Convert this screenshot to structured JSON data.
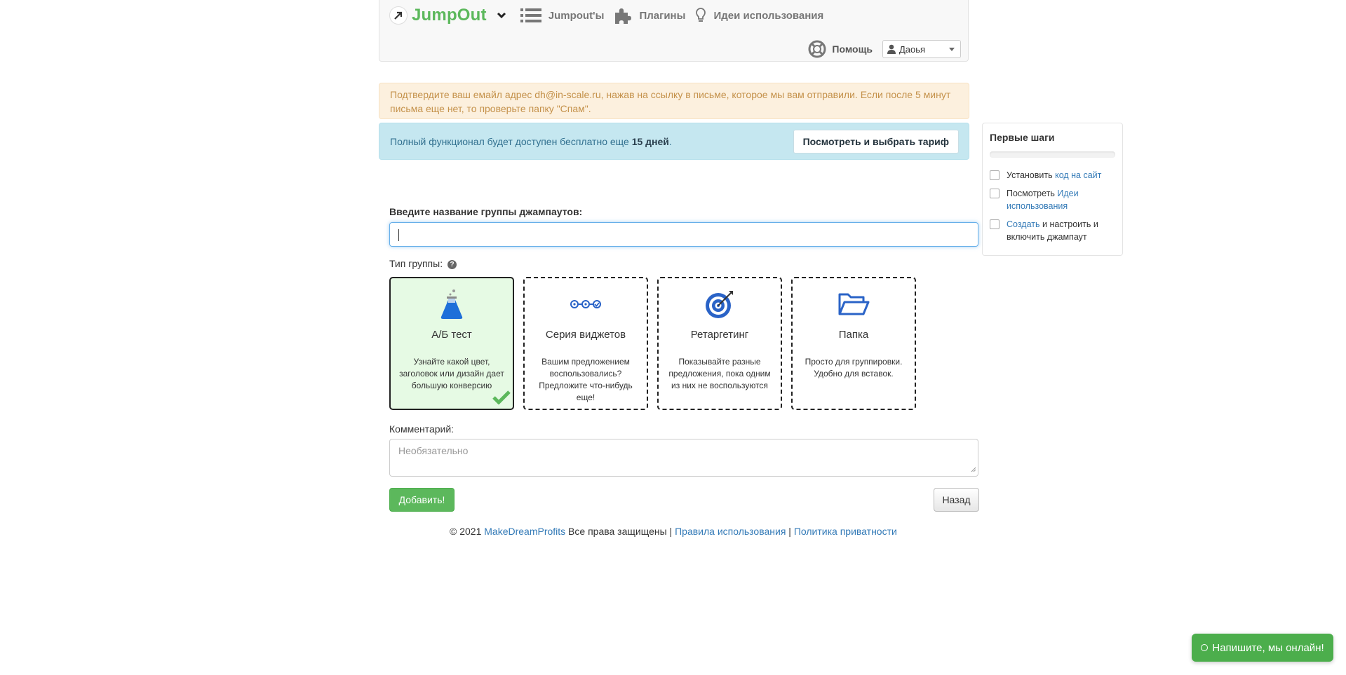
{
  "header": {
    "logo_text": "JumpOut",
    "nav": [
      {
        "label": "Jumpout'ы",
        "icon": "list-icon"
      },
      {
        "label": "Плагины",
        "icon": "puzzle-icon"
      },
      {
        "label": "Идеи использования",
        "icon": "lightbulb-icon"
      }
    ],
    "help_label": "Помощь",
    "user_name": "Даоья"
  },
  "alerts": {
    "warning_text": "Подтвердите ваш емайл адрес dh@in-scale.ru, нажав на ссылку в письме, которое мы вам отправили. Если после 5 минут письма еще нет, то проверьте папку \"Спам\".",
    "info_prefix": "Полный функционал будет доступен бесплатно еще ",
    "info_days": "15 дней",
    "info_suffix": ".",
    "tariff_button": "Посмотреть и выбрать тариф"
  },
  "first_steps": {
    "title": "Первые шаги",
    "progress": 0,
    "items": [
      {
        "before": "Установить ",
        "link": "код на сайт",
        "after": ""
      },
      {
        "before": "Посмотреть ",
        "link": "Идеи использования",
        "after": ""
      },
      {
        "before": "",
        "link": "Создать",
        "after": " и настроить и включить джампаут"
      }
    ]
  },
  "form": {
    "name_label": "Введите название группы джампаутов:",
    "name_value": "",
    "type_label": "Тип группы:",
    "types": [
      {
        "title": "А/Б тест",
        "desc": "Узнайте какой цвет, заголовок или дизайн дает большую конверсию",
        "icon": "flask-icon",
        "selected": true
      },
      {
        "title": "Серия виджетов",
        "desc": "Вашим предложением воспользовались? Предложите что-нибудь еще!",
        "icon": "chain-icon",
        "selected": false
      },
      {
        "title": "Ретаргетинг",
        "desc": "Показывайте разные предложения, пока одним из них не воспользуются",
        "icon": "target-icon",
        "selected": false
      },
      {
        "title": "Папка",
        "desc": "Просто для группировки. Удобно для вставок.",
        "icon": "folder-icon",
        "selected": false
      }
    ],
    "comment_label": "Комментарий:",
    "comment_placeholder": "Необязательно",
    "add_button": "Добавить!",
    "back_button": "Назад"
  },
  "footer": {
    "copyright": "© 2021 ",
    "company": "MakeDreamProfits",
    "rights": " Все права защищены | ",
    "terms": "Правила использования",
    "sep": " | ",
    "privacy": "Политика приватности"
  },
  "chat": {
    "label": "Напишите, мы онлайн!"
  },
  "colors": {
    "brand_green": "#5cb85c",
    "link_blue": "#337ab7",
    "warning_bg": "#fcf0de",
    "info_bg": "#c5e7f0",
    "selected_card_bg": "#e6fae4"
  }
}
